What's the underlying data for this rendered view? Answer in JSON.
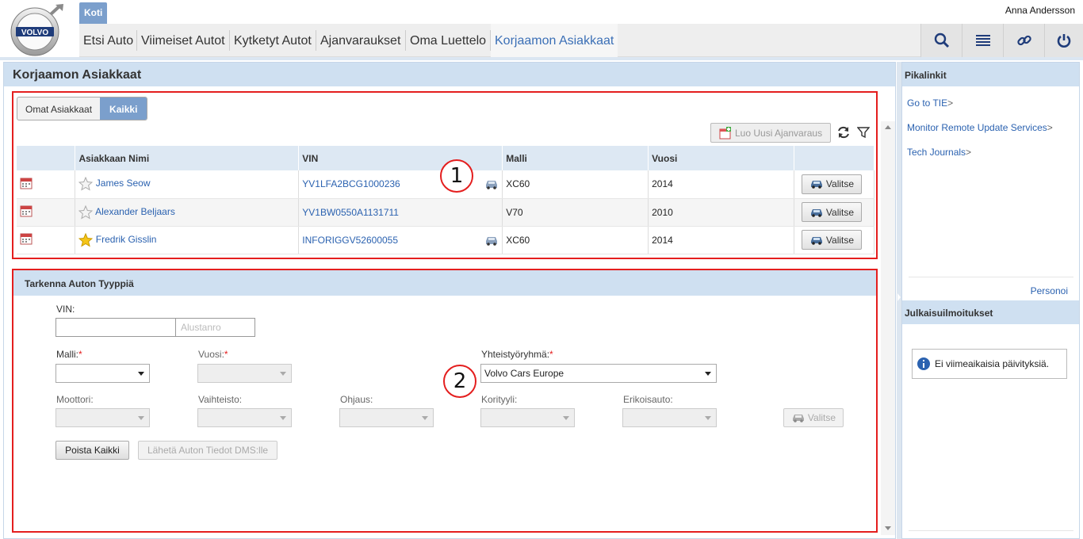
{
  "header": {
    "logo_text": "VOLVO",
    "home_tab": "Koti",
    "user_name": "Anna Andersson",
    "nav": [
      "Etsi Auto",
      "Viimeiset Autot",
      "Kytketyt Autot",
      "Ajanvaraukset",
      "Oma Luettelo",
      "Korjaamon Asiakkaat"
    ],
    "active_nav": "Korjaamon Asiakkaat",
    "icons": [
      "search-icon",
      "list-icon",
      "link-icon",
      "power-icon"
    ]
  },
  "main": {
    "title": "Korjaamon Asiakkaat",
    "segments": [
      "Omat Asiakkaat",
      "Kaikki"
    ],
    "active_segment": "Kaikki",
    "new_booking_label": "Luo Uusi Ajanvaraus",
    "table": {
      "columns": [
        "",
        "Asiakkaan Nimi",
        "VIN",
        "Malli",
        "Vuosi",
        ""
      ],
      "rows": [
        {
          "name": "James Seow",
          "favorite": false,
          "vin": "YV1LFA2BCG1000236",
          "connected": true,
          "model": "XC60",
          "year": "2014"
        },
        {
          "name": "Alexander Beljaars",
          "favorite": false,
          "vin": "YV1BW0550A1131711",
          "connected": false,
          "model": "V70",
          "year": "2010"
        },
        {
          "name": "Fredrik Gisslin",
          "favorite": true,
          "vin": "INFORIGGV52600055",
          "connected": true,
          "model": "XC60",
          "year": "2014"
        }
      ],
      "select_label": "Valitse"
    },
    "callouts": [
      "1",
      "2"
    ]
  },
  "refine": {
    "title": "Tarkenna Auton Tyyppiä",
    "vin_label": "VIN:",
    "vin_value": "",
    "vin_suffix_placeholder": "Alustanro",
    "model_label": "Malli:",
    "year_label": "Vuosi:",
    "group_label": "Yhteistyöryhmä:",
    "group_value": "Volvo Cars Europe",
    "required_mark": "*",
    "engine_label": "Moottori:",
    "gearbox_label": "Vaihteisto:",
    "steering_label": "Ohjaus:",
    "body_label": "Korityyli:",
    "special_label": "Erikoisauto:",
    "select_label": "Valitse",
    "clear_label": "Poista Kaikki",
    "send_label": "Lähetä Auton Tiedot DMS:lle"
  },
  "sidebar": {
    "quicklinks_title": "Pikalinkit",
    "links": [
      "Go to TIE",
      "Monitor Remote Update Services",
      "Tech Journals"
    ],
    "link_suffix": ">",
    "personalize": "Personoi",
    "notices_title": "Julkaisuilmoitukset",
    "notice_text": "Ei viimeaikaisia päivityksiä."
  },
  "colors": {
    "accent": "#7b9fcc",
    "panel_header": "#cfe0f1",
    "link": "#2b62b0",
    "callout_red": "#e41e1e"
  }
}
